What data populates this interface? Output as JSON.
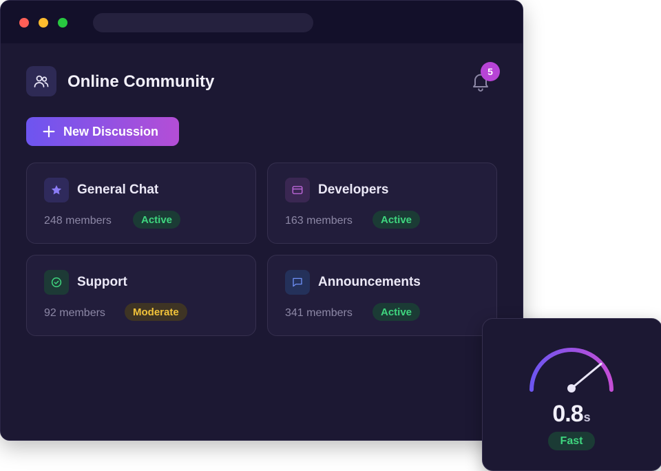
{
  "app": {
    "title": "Online Community"
  },
  "notifications": {
    "count": "5"
  },
  "actions": {
    "new_discussion_label": "New Discussion"
  },
  "groups": [
    {
      "name": "General Chat",
      "members": "248 members",
      "status": "Active",
      "icon": "star-icon"
    },
    {
      "name": "Developers",
      "members": "163 members",
      "status": "Active",
      "icon": "card-icon"
    },
    {
      "name": "Support",
      "members": "92 members",
      "status": "Moderate",
      "icon": "check-circle-icon"
    },
    {
      "name": "Announcements",
      "members": "341 members",
      "status": "Active",
      "icon": "chat-bubble-icon"
    }
  ],
  "speed": {
    "value": "0.8",
    "unit": "s",
    "label": "Fast",
    "gauge_level": 0.78
  },
  "colors": {
    "accent_start": "#6d55f0",
    "accent_end": "#b44ed6",
    "active": "#3fd67f",
    "moderate": "#f2c33a",
    "background": "#1c1833"
  }
}
